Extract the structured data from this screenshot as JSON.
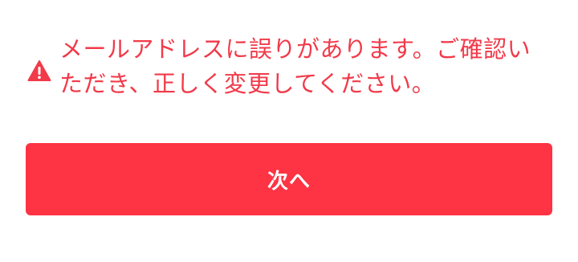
{
  "error": {
    "icon": "warning-triangle-icon",
    "message": "メールアドレスに誤りがあります。ご確認いただき、正しく変更してください。",
    "color": "#f13a4a"
  },
  "next_button": {
    "label": "次へ",
    "background": "#fe3344",
    "text_color": "#ffffff"
  }
}
